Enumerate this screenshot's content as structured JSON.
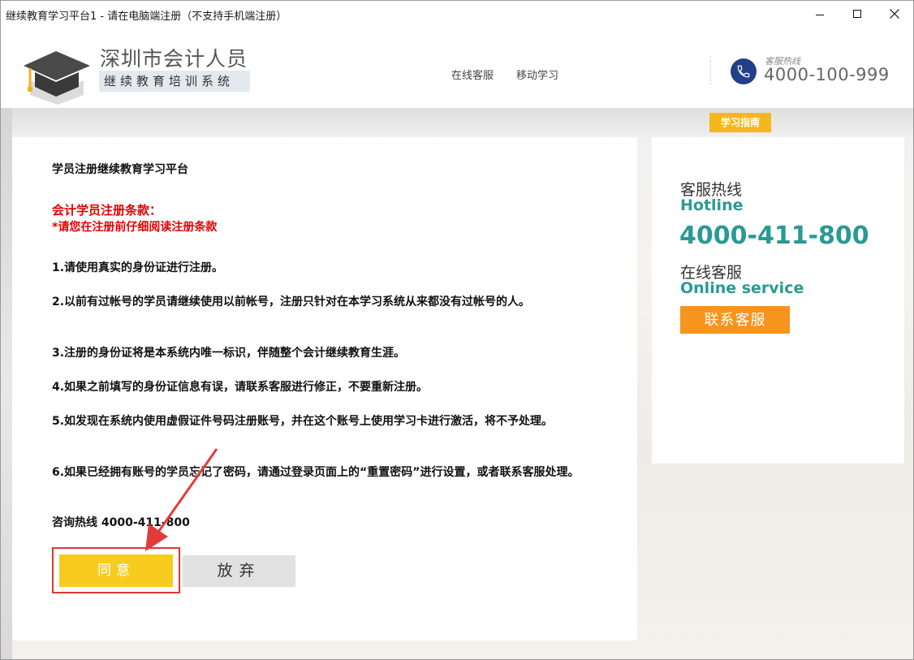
{
  "window": {
    "title": "继续教育学习平台1 - 请在电脑端注册（不支持手机端注册）"
  },
  "header": {
    "brand_title": "深圳市会计人员",
    "brand_subtitle": "继续教育培训系统",
    "nav": [
      "在线客服",
      "移动学习"
    ],
    "hotline_label": "客服热线",
    "hotline_number": "4000-100-999"
  },
  "guide_tag": "学习指南",
  "content": {
    "heading": "学员注册继续教育学习平台",
    "terms_title": "会计学员注册条款：",
    "terms_notice": "*请您在注册前仔细阅读注册条款",
    "terms": [
      "1.请使用真实的身份证进行注册。",
      "2.以前有过帐号的学员请继续使用以前帐号，注册只针对在本学习系统从来都没有过帐号的人。",
      "3.注册的身份证将是本系统内唯一标识，伴随整个会计继续教育生涯。",
      "4.如果之前填写的身份证信息有误，请联系客服进行修正，不要重新注册。",
      "5.如发现在系统内使用虚假证件号码注册账号，并在这个账号上使用学习卡进行激活，将不予处理。",
      "6.如果已经拥有账号的学员忘记了密码，请通过登录页面上的“重置密码”进行设置，或者联系客服处理。"
    ],
    "consult_line": "咨询热线 4000-411-800",
    "agree_label": "同意",
    "giveup_label": "放弃"
  },
  "side": {
    "hotline_cn": "客服热线",
    "hotline_en": "Hotline",
    "hotline_number": "4000-411-800",
    "online_cn": "在线客服",
    "online_en": "Online service",
    "contact_button": "联系客服"
  },
  "colors": {
    "accent_teal": "#2a9a93",
    "agree_yellow": "#f7cc1e",
    "contact_orange": "#f6941d",
    "terms_red": "#e00000",
    "highlight_red": "#e03535",
    "phone_blue": "#233f87"
  },
  "icons": {
    "logo": "graduation-cap-icon",
    "phone": "phone-icon",
    "arrow": "red-pointer-arrow"
  }
}
